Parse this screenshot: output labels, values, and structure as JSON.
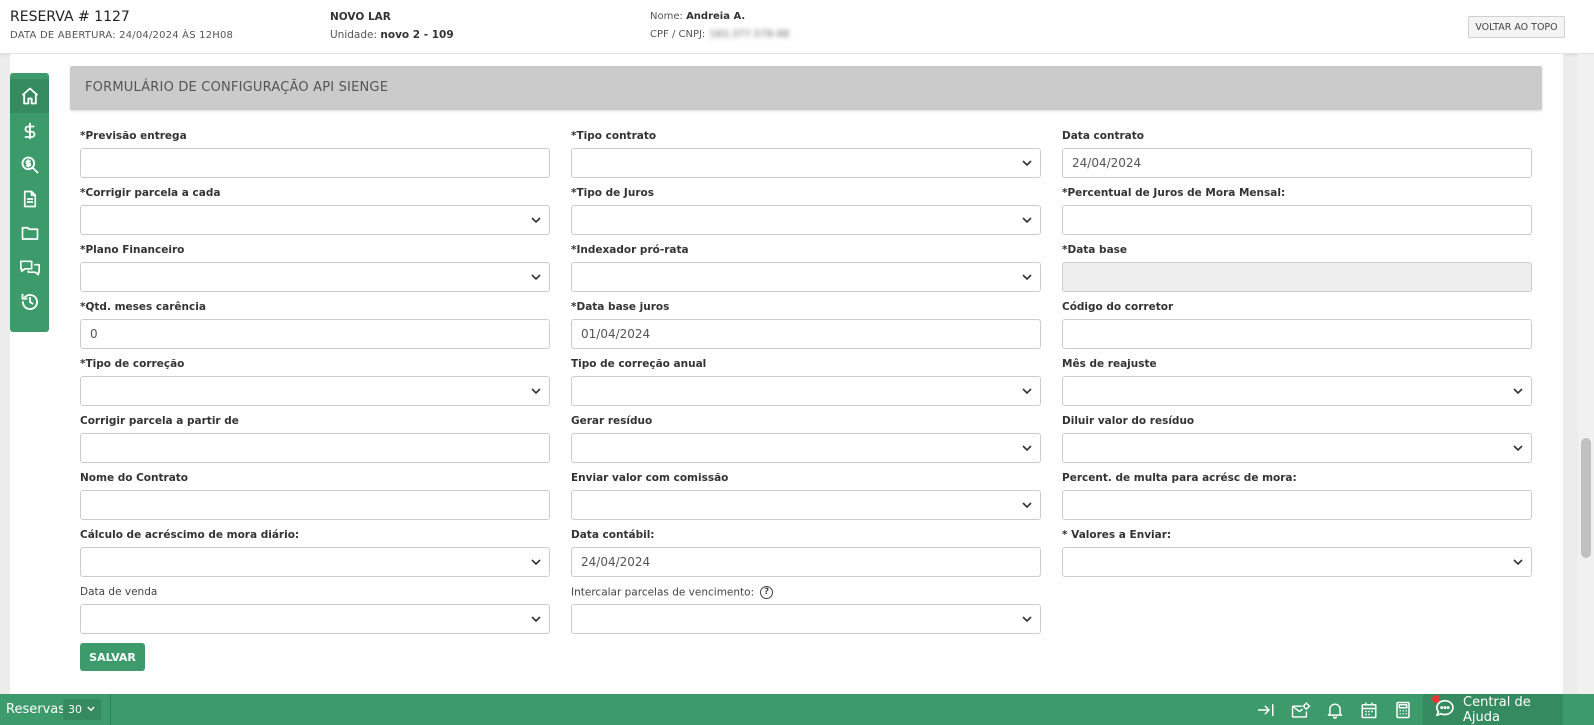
{
  "header": {
    "title": "RESERVA # 1127",
    "opening_date": "DATA DE ABERTURA: 24/04/2024 ÀS 12H08",
    "enterprise": "NOVO LAR",
    "unit_label": "Unidade:",
    "unit_value": "novo 2 - 109",
    "name_label": "Nome:",
    "name_value": "Andreia A.",
    "cpf_label": "CPF / CNPJ:",
    "cpf_value": "183.377.578-98",
    "back_to_top": "VOLTAR AO TOPO"
  },
  "sidebar": {
    "items": [
      {
        "icon": "home-icon",
        "active": true
      },
      {
        "icon": "dollar-icon"
      },
      {
        "icon": "search-dollar-icon"
      },
      {
        "icon": "document-icon"
      },
      {
        "icon": "folder-icon"
      },
      {
        "icon": "chat-icon"
      },
      {
        "icon": "history-icon"
      }
    ]
  },
  "form": {
    "title": "FORMULÁRIO DE CONFIGURAÇÃO API SIENGE",
    "fields": {
      "previsao_entrega": {
        "label": "*Previsão entrega",
        "value": ""
      },
      "tipo_contrato": {
        "label": "*Tipo contrato",
        "value": ""
      },
      "data_contrato": {
        "label": "Data contrato",
        "value": "24/04/2024"
      },
      "corrigir_parcela_cada": {
        "label": "*Corrigir parcela a cada",
        "value": ""
      },
      "tipo_juros": {
        "label": "*Tipo de Juros",
        "value": ""
      },
      "percentual_juros_mora": {
        "label": "*Percentual de Juros de Mora Mensal:",
        "value": ""
      },
      "plano_financeiro": {
        "label": "*Plano Financeiro",
        "value": ""
      },
      "indexador_pro_rata": {
        "label": "*Indexador pró-rata",
        "value": ""
      },
      "data_base": {
        "label": "*Data base",
        "value": ""
      },
      "qtd_meses_carencia": {
        "label": "*Qtd. meses carência",
        "value": "0"
      },
      "data_base_juros": {
        "label": "*Data base juros",
        "value": "01/04/2024"
      },
      "codigo_corretor": {
        "label": "Código do corretor",
        "value": ""
      },
      "tipo_correcao": {
        "label": "*Tipo de correção",
        "value": ""
      },
      "tipo_correcao_anual": {
        "label": "Tipo de correção anual",
        "value": ""
      },
      "mes_reajuste": {
        "label": "Mês de reajuste",
        "value": ""
      },
      "corrigir_parcela_partir": {
        "label": "Corrigir parcela a partir de",
        "value": ""
      },
      "gerar_residuo": {
        "label": "Gerar resíduo",
        "value": ""
      },
      "diluir_residuo": {
        "label": "Diluir valor do resíduo",
        "value": ""
      },
      "nome_contrato": {
        "label": "Nome do Contrato",
        "value": ""
      },
      "enviar_comissao": {
        "label": "Enviar valor com comissão",
        "value": ""
      },
      "percent_multa": {
        "label": "Percent. de multa para acrésc de mora:",
        "value": ""
      },
      "calculo_mora_diario": {
        "label": "Cálculo de acréscimo de mora diário:",
        "value": ""
      },
      "data_contabil": {
        "label": "Data contábil:",
        "value": "24/04/2024"
      },
      "valores_enviar": {
        "label": "* Valores a Enviar:",
        "value": ""
      },
      "data_venda": {
        "label": "Data de venda",
        "value": ""
      },
      "intercalar_parcelas": {
        "label": "Intercalar parcelas de vencimento:",
        "value": ""
      }
    },
    "help_symbol": "?",
    "save_label": "SALVAR"
  },
  "bottom_bar": {
    "section_label": "Reservas",
    "page_size": "30",
    "icons": [
      "sidebar-expand-icon",
      "mail-settings-icon",
      "bell-icon",
      "calendar-icon",
      "calculator-icon"
    ],
    "help_label": "Central de Ajuda",
    "help_has_notification": true
  },
  "colors": {
    "brand_green": "#3d9a6b",
    "form_header_bg": "#cbcbcb",
    "notification_red": "#e53935"
  }
}
